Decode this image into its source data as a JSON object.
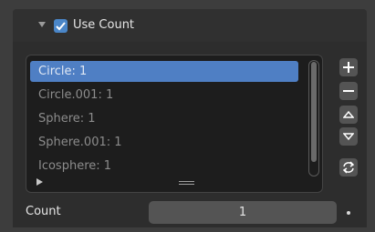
{
  "header": {
    "label": "Use Count",
    "checked": true
  },
  "list": {
    "items": [
      {
        "label": "Circle: 1",
        "selected": true
      },
      {
        "label": "Circle.001: 1",
        "selected": false
      },
      {
        "label": "Sphere: 1",
        "selected": false
      },
      {
        "label": "Sphere.001: 1",
        "selected": false
      },
      {
        "label": "Icosphere: 1",
        "selected": false
      }
    ]
  },
  "side_buttons": [
    "plus-icon",
    "minus-icon",
    "move-up-icon",
    "move-down-icon",
    "refresh-icon"
  ],
  "count": {
    "label": "Count",
    "value": "1"
  },
  "colors": {
    "accent": "#4f7fc4",
    "checkbox": "#4a86c8"
  }
}
